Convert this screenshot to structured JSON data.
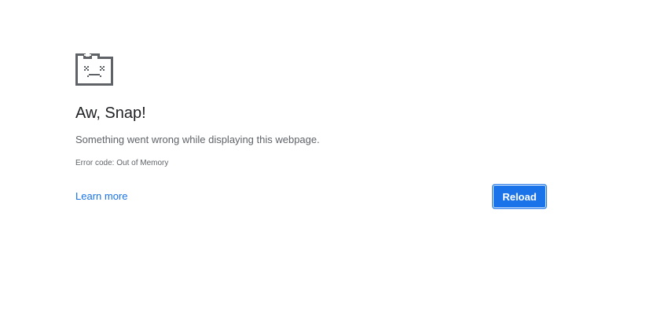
{
  "error_page": {
    "icon": "sad-tab-icon",
    "title": "Aw, Snap!",
    "message": "Something went wrong while displaying this webpage.",
    "error_code": "Error code: Out of Memory",
    "learn_more_label": "Learn more",
    "reload_label": "Reload"
  },
  "colors": {
    "background": "#ffffff",
    "title": "#202124",
    "text": "#5f6368",
    "link": "#1a73e8",
    "button": "#1a73e8",
    "icon": "#5f6368"
  }
}
